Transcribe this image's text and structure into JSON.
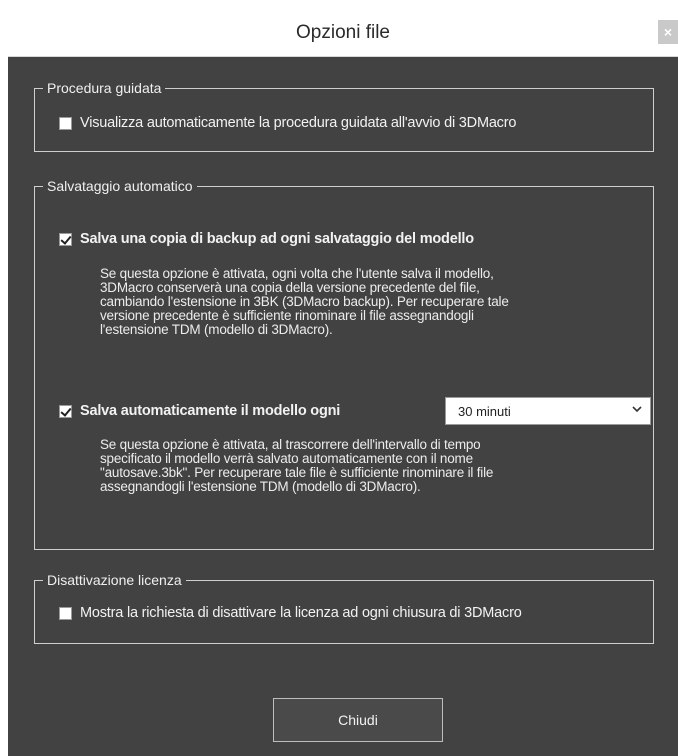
{
  "window": {
    "title": "Opzioni file",
    "close_glyph": "×"
  },
  "procedura_guidata": {
    "legend": "Procedura guidata",
    "checkbox": {
      "label": "Visualizza automaticamente la procedura guidata all'avvio di 3DMacro",
      "checked": false
    }
  },
  "salvataggio_automatico": {
    "legend": "Salvataggio automatico",
    "backup": {
      "label": "Salva una copia di backup ad ogni salvataggio del modello",
      "checked": true,
      "description": [
        "Se questa opzione è attivata, ogni volta che l'utente salva il modello,",
        "3DMacro conserverà una copia della versione precedente del file,",
        "cambiando l'estensione in 3BK (3DMacro backup). Per recuperare tale",
        "versione precedente è sufficiente rinominare il file assegnandogli",
        "l'estensione TDM (modello di 3DMacro)."
      ]
    },
    "autosave": {
      "label": "Salva automaticamente il modello ogni",
      "checked": true,
      "interval_value": "30 minuti",
      "dropdown_icon": "chevron-down-icon",
      "description": [
        "Se questa opzione è attivata, al trascorrere dell'intervallo di tempo",
        "specificato il modello verrà salvato automaticamente con il nome",
        "\"autosave.3bk\". Per recuperare tale file è sufficiente rinominare il file",
        "assegnandogli l'estensione TDM (modello di 3DMacro)."
      ]
    }
  },
  "disattivazione_licenza": {
    "legend": "Disattivazione licenza",
    "checkbox": {
      "label": "Mostra la richiesta di disattivare la licenza ad ogni chiusura di 3DMacro",
      "checked": false
    }
  },
  "footer": {
    "close_button_label": "Chiudi"
  },
  "colors": {
    "background": "#424242",
    "titlebar": "#ffffff",
    "text": "#f2f2f2",
    "border": "#cfcfcf"
  }
}
